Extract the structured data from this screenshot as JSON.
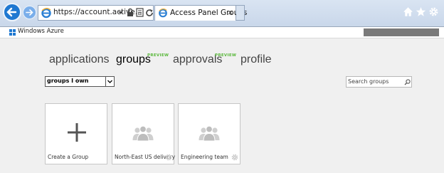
{
  "browser": {
    "address": "https://account.active...",
    "tab_title": "Access Panel Groups",
    "tab_close": "×"
  },
  "header": {
    "brand": "Windows Azure"
  },
  "nav": {
    "items": [
      {
        "label": "applications"
      },
      {
        "label": "groups",
        "badge": "PREVIEW"
      },
      {
        "label": "approvals",
        "badge": "PREVIEW"
      },
      {
        "label": "profile"
      }
    ],
    "active": "groups"
  },
  "filter": {
    "selected": "groups I own"
  },
  "search": {
    "placeholder": "Search groups"
  },
  "tiles": [
    {
      "label": "Create a Group",
      "icon": "plus-icon"
    },
    {
      "label": "North-East US delivery",
      "icon": "group-people-icon"
    },
    {
      "label": "Engineering team",
      "icon": "group-people-icon"
    }
  ],
  "colors": {
    "accent_blue": "#1f78d1",
    "preview_green": "#5ab83c",
    "tile_icon_gray": "#c8c8c8"
  }
}
